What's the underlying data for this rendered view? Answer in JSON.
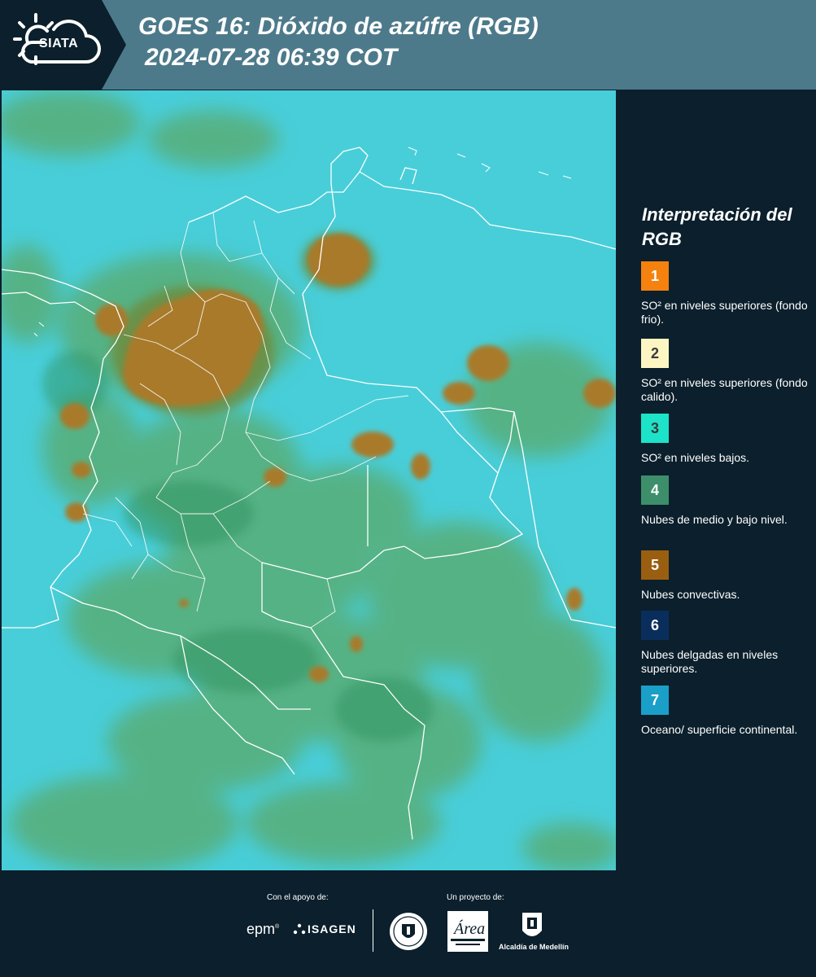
{
  "header": {
    "logo_text": "SIATA",
    "title_line1": "GOES 16: Dióxido de azúfre (RGB)",
    "title_line2": "2024-07-28 06:39 COT"
  },
  "legend": {
    "title": "Interpretación del RGB",
    "items": [
      {
        "number": "1",
        "color": "#f5820f",
        "number_color": "#ffffff",
        "text": "SO² en niveles superiores (fondo frio)."
      },
      {
        "number": "2",
        "color": "#fdf6c3",
        "number_color": "#3a3a3a",
        "text": "SO² en niveles superiores (fondo calido)."
      },
      {
        "number": "3",
        "color": "#1de3c8",
        "number_color": "#3a3a3a",
        "text": "SO² en niveles bajos."
      },
      {
        "number": "4",
        "color": "#3c8f6a",
        "number_color": "#ffffff",
        "text": "Nubes de medio y bajo nivel."
      },
      {
        "number": "5",
        "color": "#9a5e10",
        "number_color": "#ffffff",
        "text": "Nubes convectivas."
      },
      {
        "number": "6",
        "color": "#0a2e5c",
        "number_color": "#ffffff",
        "text": "Nubes delgadas en niveles superiores."
      },
      {
        "number": "7",
        "color": "#1a9fc8",
        "number_color": "#ffffff",
        "text": "Oceano/ superficie continental."
      }
    ]
  },
  "footer": {
    "support_caption": "Con el apoyo de:",
    "project_caption": "Un proyecto de:",
    "sponsors": [
      "epm",
      "ISAGEN"
    ],
    "partners": [
      "Área Metropolitana Valle de Aburrá",
      "Alcaldía de Medellín"
    ],
    "alcaldia_label": "Alcaldía de Medellín"
  },
  "map": {
    "background_color": "#3cc9d6",
    "convective_color": "#a87a2c",
    "lowcloud_color": "#5aa96a",
    "border_color": "#ffffff"
  }
}
